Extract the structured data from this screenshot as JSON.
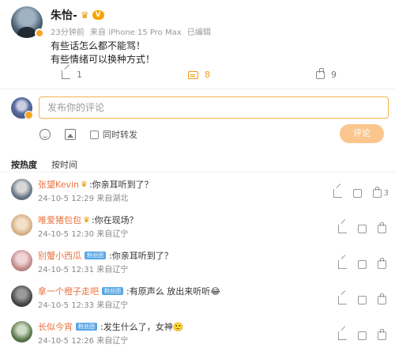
{
  "post": {
    "author": "朱怡-",
    "level_badge": "V",
    "time": "23分钟前",
    "source": "来自 iPhone 15 Pro Max",
    "edited": "已编辑",
    "lines": [
      "有些话怎么都不能骂！",
      "有些情绪可以换种方式！"
    ],
    "share_count": "1",
    "comment_count": "8",
    "like_count": "9"
  },
  "composer": {
    "placeholder": "发布你的评论",
    "repost_label": "同时转发",
    "submit_label": "评论"
  },
  "sort": {
    "hot": "按热度",
    "time": "按时间"
  },
  "comments": [
    {
      "user": "张望Kevin",
      "crown": true,
      "tag": "",
      "text": ":你亲耳听到了？",
      "time": "24-10-5 12:29",
      "location": "来自湖北",
      "likes": "3",
      "avatar": "#6b7a8a"
    },
    {
      "user": "唯爱猪包包",
      "crown": true,
      "tag": "",
      "text": ":你在现场？",
      "time": "24-10-5 12:30",
      "location": "来自辽宁",
      "likes": "",
      "avatar": "#d9b48a"
    },
    {
      "user": "别蟹小西瓜",
      "crown": false,
      "tag": "粉丝团",
      "text": ":你亲耳听到了？",
      "time": "24-10-5 12:31",
      "location": "来自辽宁",
      "likes": "",
      "avatar": "#c58e8e"
    },
    {
      "user": "拿一个橙子走吧",
      "crown": false,
      "tag": "粉丝团",
      "text": ":有原声么 放出来听听😂",
      "time": "24-10-5 12:33",
      "location": "来自辽宁",
      "likes": "",
      "avatar": "#4a4a4a"
    },
    {
      "user": "长似今宵",
      "crown": false,
      "tag": "粉丝团",
      "text": ":发生什么了，女神🙂",
      "time": "24-10-5 12:26",
      "location": "来自辽宁",
      "likes": "",
      "avatar": "#5e7a4e"
    }
  ],
  "colors": {
    "accent": "#f39a12",
    "username": "#eb7340",
    "submit_bg": "#fbc68e"
  }
}
